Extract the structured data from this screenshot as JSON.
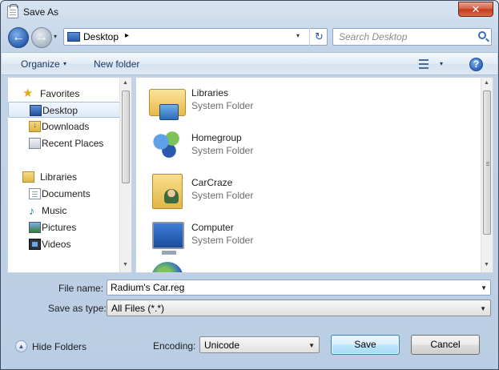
{
  "window": {
    "title": "Save As",
    "close_glyph": "✕"
  },
  "nav": {
    "back_glyph": "←",
    "forward_glyph": "→",
    "history_glyph": "▾",
    "address": {
      "location": "Desktop",
      "separator": "▸",
      "dropdown_glyph": "▾",
      "refresh_glyph": "↻"
    },
    "search": {
      "placeholder": "Search Desktop"
    }
  },
  "toolbar": {
    "organize_label": "Organize",
    "organize_caret": "▾",
    "new_folder_label": "New folder",
    "views_caret": "▾",
    "help_glyph": "?"
  },
  "sidebar": {
    "favorites": {
      "label": "Favorites",
      "items": [
        {
          "label": "Desktop",
          "icon": "desktop-icon",
          "selected": true
        },
        {
          "label": "Downloads",
          "icon": "downloads-icon"
        },
        {
          "label": "Recent Places",
          "icon": "recent-places-icon"
        }
      ]
    },
    "libraries": {
      "label": "Libraries",
      "items": [
        {
          "label": "Documents",
          "icon": "documents-icon"
        },
        {
          "label": "Music",
          "icon": "music-icon"
        },
        {
          "label": "Pictures",
          "icon": "pictures-icon"
        },
        {
          "label": "Videos",
          "icon": "videos-icon"
        }
      ]
    },
    "scroll_up_glyph": "▲",
    "scroll_down_glyph": "▼"
  },
  "files": [
    {
      "name": "Libraries",
      "type": "System Folder",
      "icon": "libraries-folder-icon"
    },
    {
      "name": "Homegroup",
      "type": "System Folder",
      "icon": "homegroup-icon"
    },
    {
      "name": "CarCraze",
      "type": "System Folder",
      "icon": "user-folder-icon"
    },
    {
      "name": "Computer",
      "type": "System Folder",
      "icon": "computer-icon"
    },
    {
      "name": "",
      "type": "",
      "icon": "network-globe-icon"
    }
  ],
  "form": {
    "file_name_label": "File name:",
    "file_name_value": "Radium's Car.reg",
    "save_type_label": "Save as type:",
    "save_type_value": "All Files  (*.*)",
    "encoding_label": "Encoding:",
    "encoding_value": "Unicode",
    "dropdown_glyph": "▼"
  },
  "footer": {
    "hide_folders_label": "Hide Folders",
    "hide_folders_glyph": "▲",
    "save_label": "Save",
    "cancel_label": "Cancel"
  },
  "colors": {
    "accent": "#2a62b8",
    "selection_bg": "#dde9f7",
    "close_button": "#c0391c"
  }
}
